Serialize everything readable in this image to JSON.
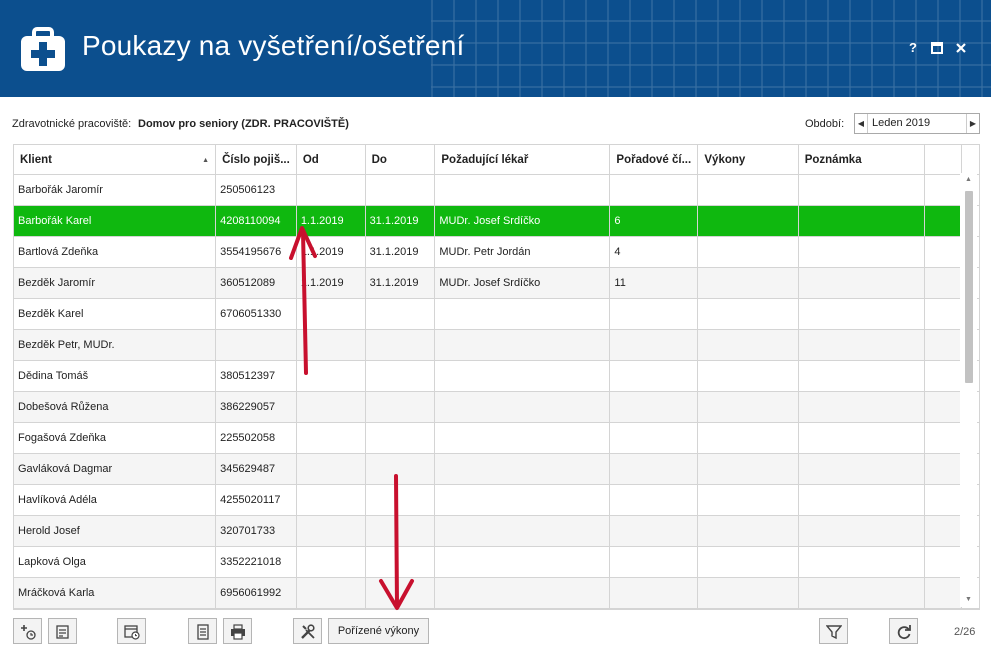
{
  "window": {
    "title": "Poukazy na vyšetření/ošetření",
    "help_label": "?",
    "maximize_label": "■",
    "close_label": "✕"
  },
  "filter": {
    "workplace_label": "Zdravotnické pracoviště:",
    "workplace_value": "Domov pro seniory (ZDR. PRACOVIŠTĚ)",
    "period_label": "Období:",
    "period_value": "Leden 2019"
  },
  "table": {
    "columns": [
      "Klient",
      "Číslo pojiš...",
      "Od",
      "Do",
      "Požadující lékař",
      "Pořadové čí...",
      "Výkony",
      "Poznámka"
    ],
    "selected_row": 1,
    "rows": [
      {
        "klient": "Barbořák Jaromír",
        "cislo": "250506123",
        "od": "",
        "do": "",
        "lekar": "",
        "poradove": "",
        "vykony": "",
        "poznamka": ""
      },
      {
        "klient": "Barbořák Karel",
        "cislo": "4208110094",
        "od": "1.1.2019",
        "do": "31.1.2019",
        "lekar": "MUDr. Josef Srdíčko",
        "poradove": "6",
        "vykony": "",
        "poznamka": ""
      },
      {
        "klient": "Bartlová Zdeňka",
        "cislo": "3554195676",
        "od": "1.1.2019",
        "do": "31.1.2019",
        "lekar": "MUDr. Petr Jordán",
        "poradove": "4",
        "vykony": "",
        "poznamka": ""
      },
      {
        "klient": "Bezděk Jaromír",
        "cislo": "360512089",
        "od": "1.1.2019",
        "do": "31.1.2019",
        "lekar": "MUDr. Josef Srdíčko",
        "poradove": "11",
        "vykony": "",
        "poznamka": ""
      },
      {
        "klient": "Bezděk Karel",
        "cislo": "6706051330",
        "od": "",
        "do": "",
        "lekar": "",
        "poradove": "",
        "vykony": "",
        "poznamka": ""
      },
      {
        "klient": "Bezděk Petr, MUDr.",
        "cislo": "",
        "od": "",
        "do": "",
        "lekar": "",
        "poradove": "",
        "vykony": "",
        "poznamka": ""
      },
      {
        "klient": "Dědina Tomáš",
        "cislo": "380512397",
        "od": "",
        "do": "",
        "lekar": "",
        "poradove": "",
        "vykony": "",
        "poznamka": ""
      },
      {
        "klient": "Dobešová Růžena",
        "cislo": "386229057",
        "od": "",
        "do": "",
        "lekar": "",
        "poradove": "",
        "vykony": "",
        "poznamka": ""
      },
      {
        "klient": "Fogašová Zdeňka",
        "cislo": "225502058",
        "od": "",
        "do": "",
        "lekar": "",
        "poradove": "",
        "vykony": "",
        "poznamka": ""
      },
      {
        "klient": "Gavláková Dagmar",
        "cislo": "345629487",
        "od": "",
        "do": "",
        "lekar": "",
        "poradove": "",
        "vykony": "",
        "poznamka": ""
      },
      {
        "klient": "Havlíková Adéla",
        "cislo": "4255020117",
        "od": "",
        "do": "",
        "lekar": "",
        "poradove": "",
        "vykony": "",
        "poznamka": ""
      },
      {
        "klient": "Herold Josef",
        "cislo": "320701733",
        "od": "",
        "do": "",
        "lekar": "",
        "poradove": "",
        "vykony": "",
        "poznamka": ""
      },
      {
        "klient": "Lapková Olga",
        "cislo": "3352221018",
        "od": "",
        "do": "",
        "lekar": "",
        "poradove": "",
        "vykony": "",
        "poznamka": ""
      },
      {
        "klient": "Mráčková Karla",
        "cislo": "6956061992",
        "od": "",
        "do": "",
        "lekar": "",
        "poradove": "",
        "vykony": "",
        "poznamka": ""
      }
    ]
  },
  "toolbar": {
    "porizene_label": "Pořízené výkony",
    "pager": "2/26",
    "icons": [
      "add-clock-icon",
      "document-edit-icon",
      "calendar-clock-icon",
      "document-icon",
      "print-icon",
      "tools-icon",
      "filter-icon",
      "refresh-icon"
    ]
  },
  "colors": {
    "header_bg": "#0c4f8e",
    "selected_row": "#0fb80f",
    "annotation_arrow": "#c8102e"
  }
}
